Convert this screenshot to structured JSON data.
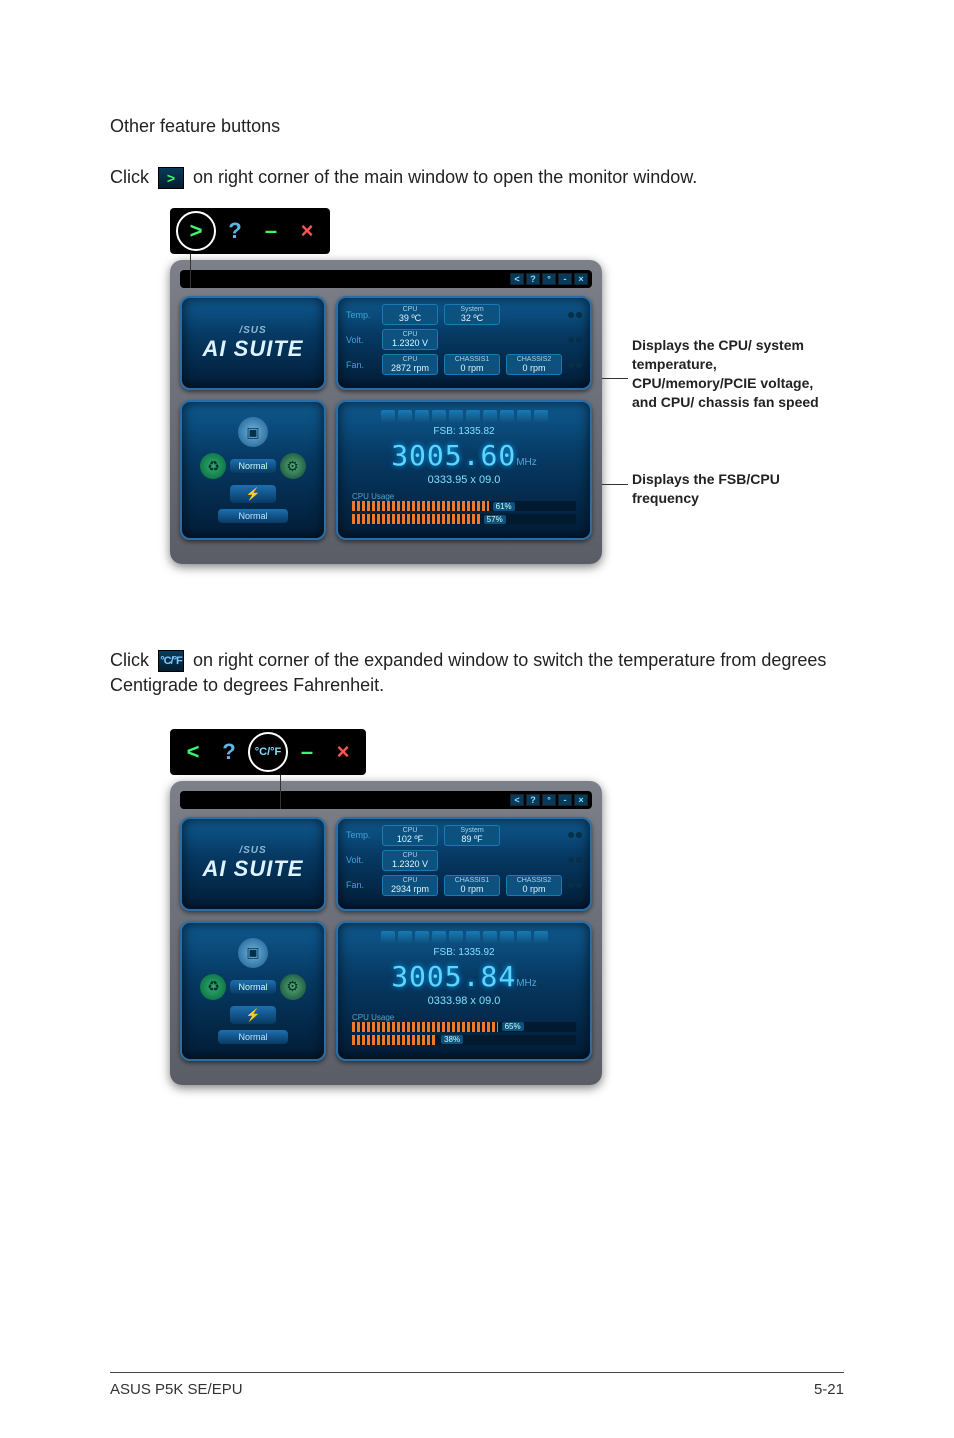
{
  "page": {
    "heading": "Other feature buttons",
    "instruction1_pre": "Click",
    "instruction1_post": "on right corner of the main window to open the monitor window.",
    "instruction2_pre": "Click",
    "instruction2_post": "on right corner of the expanded window to switch the temperature from degrees Centigrade to degrees Fahrenheit."
  },
  "toolbar_icons": {
    "expand": ">",
    "help": "?",
    "collapse": "<",
    "temp_unit": "°C/°F",
    "minimize": "–",
    "close": "×"
  },
  "callouts": {
    "monitor": "Displays the CPU/ system temperature, CPU/memory/PCIE voltage, and CPU/ chassis fan speed",
    "freq": "Displays the FSB/CPU frequency"
  },
  "app": {
    "brand": "/SUS",
    "suite": "AI SUITE",
    "mode": "Normal",
    "normal_badge": "Normal",
    "titlebar_btns": [
      "<",
      "?",
      "°",
      "-",
      "×"
    ]
  },
  "screenshot1": {
    "temp": {
      "label": "Temp.",
      "cpu_t": "CPU",
      "cpu_v": "39 ºC",
      "sys_t": "System",
      "sys_v": "32 ºC"
    },
    "volt": {
      "label": "Volt.",
      "cpu_t": "CPU",
      "cpu_v": "1.2320 V"
    },
    "fan": {
      "label": "Fan.",
      "cpu_t": "CPU",
      "cpu_v": "2872 rpm",
      "ch1_t": "CHASSIS1",
      "ch1_v": "0 rpm",
      "ch2_t": "CHASSIS2",
      "ch2_v": "0 rpm"
    },
    "freq": {
      "fsb": "FSB: 1335.82",
      "cpu": "3005.60",
      "unit": "MHz",
      "mult": "0333.95 x 09.0",
      "usage_label": "CPU Usage",
      "u1": "61%",
      "u1_w": 61,
      "u2": "57%",
      "u2_w": 57
    }
  },
  "screenshot2": {
    "temp": {
      "label": "Temp.",
      "cpu_t": "CPU",
      "cpu_v": "102 ºF",
      "sys_t": "System",
      "sys_v": "89 ºF"
    },
    "volt": {
      "label": "Volt.",
      "cpu_t": "CPU",
      "cpu_v": "1.2320 V"
    },
    "fan": {
      "label": "Fan.",
      "cpu_t": "CPU",
      "cpu_v": "2934 rpm",
      "ch1_t": "CHASSIS1",
      "ch1_v": "0 rpm",
      "ch2_t": "CHASSIS2",
      "ch2_v": "0 rpm"
    },
    "freq": {
      "fsb": "FSB: 1335.92",
      "cpu": "3005.84",
      "unit": "MHz",
      "mult": "0333.98 x 09.0",
      "usage_label": "CPU Usage",
      "u1": "65%",
      "u1_w": 65,
      "u2": "38%",
      "u2_w": 38
    }
  },
  "footer": {
    "left": "ASUS P5K SE/EPU",
    "right": "5-21"
  }
}
